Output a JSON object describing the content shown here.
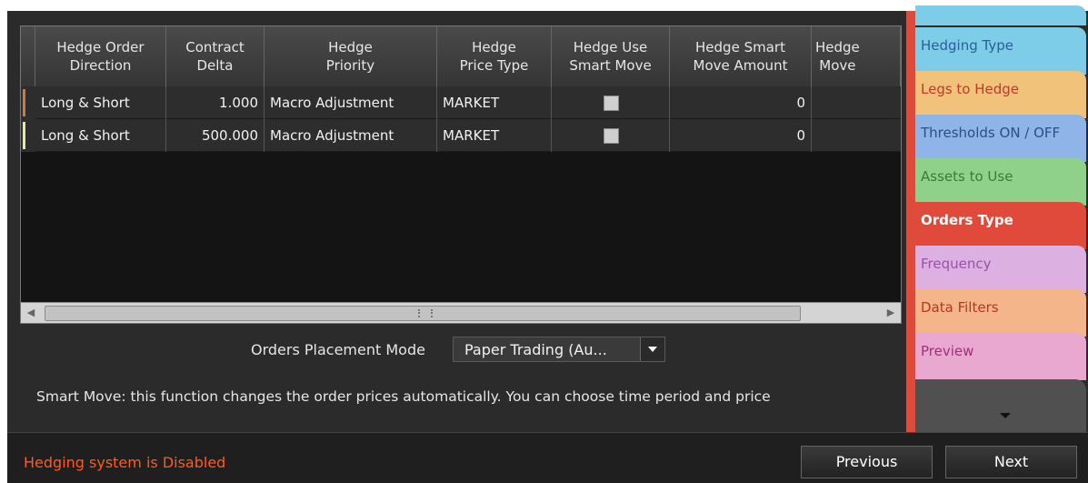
{
  "grid": {
    "headers": [
      {
        "label": "Hedge Order\nDirection"
      },
      {
        "label": "Contract\nDelta"
      },
      {
        "label": "Hedge\nPriority"
      },
      {
        "label": "Hedge\nPrice Type"
      },
      {
        "label": "Hedge Use\nSmart Move"
      },
      {
        "label": "Hedge Smart\nMove Amount"
      },
      {
        "label": "Hedge\nMove"
      }
    ],
    "rows": [
      {
        "direction": "Long & Short",
        "delta": "1.000",
        "priority": "Macro Adjustment",
        "price_type": "MARKET",
        "smart_move": false,
        "amount": "0",
        "marker_color": "#d07a3a"
      },
      {
        "direction": "Long & Short",
        "delta": "500.000",
        "priority": "Macro Adjustment",
        "price_type": "MARKET",
        "smart_move": false,
        "amount": "0",
        "marker_color": "#e6e8a0"
      }
    ]
  },
  "orders_mode": {
    "label": "Orders Placement Mode",
    "value": "Paper Trading (Au..."
  },
  "hint": "Smart Move: this function changes the order prices automatically. You can choose time period and price",
  "status": {
    "text": "Hedging system is Disabled",
    "color": "#ff5a1f"
  },
  "buttons": {
    "previous": "Previous",
    "next": "Next"
  },
  "tabs": [
    {
      "label": "Hedging Type",
      "color": "#7ecde8",
      "text_color": "#2a5f9a"
    },
    {
      "label": "Legs to Hedge",
      "color": "#f1c27a",
      "text_color": "#c0392b"
    },
    {
      "label": "Thresholds ON / OFF",
      "color": "#8fb4e8",
      "text_color": "#2a4f8a"
    },
    {
      "label": "Assets to Use",
      "color": "#8fd08a",
      "text_color": "#3a7a3a"
    },
    {
      "label": "Orders Type",
      "color": "#e04a3a",
      "text_color": "#ffffff",
      "active": true
    },
    {
      "label": "Frequency",
      "color": "#dcb0e0",
      "text_color": "#9a50a8"
    },
    {
      "label": "Data Filters",
      "color": "#f5b58a",
      "text_color": "#b03a20"
    },
    {
      "label": "Preview",
      "color": "#e8a8d0",
      "text_color": "#a0307a"
    }
  ]
}
